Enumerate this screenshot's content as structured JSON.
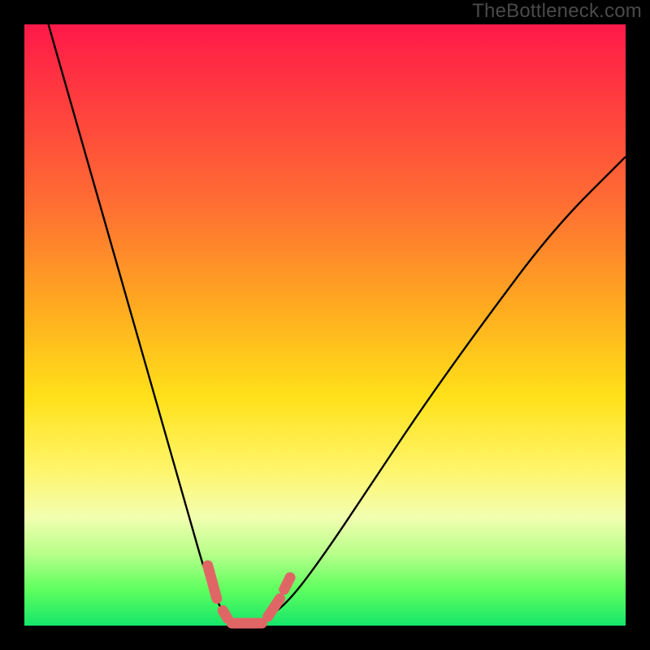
{
  "watermark": "TheBottleneck.com",
  "colors": {
    "background": "#000000",
    "gradient_top": "#ff1a49",
    "gradient_mid": "#ffe11a",
    "gradient_bottom": "#16e66a",
    "curve": "#000000",
    "marker": "#e06666"
  },
  "chart_data": {
    "type": "line",
    "title": "",
    "xlabel": "",
    "ylabel": "",
    "xlim": [
      0,
      100
    ],
    "ylim": [
      0,
      100
    ],
    "grid": false,
    "legend": false,
    "series": [
      {
        "name": "bottleneck-curve",
        "x": [
          4,
          8,
          12,
          16,
          20,
          24,
          28,
          30,
          32,
          34,
          36,
          38,
          40,
          44,
          50,
          58,
          66,
          76,
          88,
          100
        ],
        "y": [
          100,
          86,
          72,
          58,
          44,
          30,
          16,
          9,
          4,
          1,
          0,
          0,
          1,
          4,
          12,
          24,
          36,
          50,
          66,
          78
        ]
      }
    ],
    "markers": [
      {
        "name": "valley-left-dash",
        "x0": 30.5,
        "y0": 10,
        "x1": 32,
        "y1": 4.5
      },
      {
        "name": "valley-left-dot",
        "x0": 33,
        "y0": 2.5,
        "x1": 33.8,
        "y1": 1.2
      },
      {
        "name": "valley-floor",
        "x0": 34.5,
        "y0": 0.4,
        "x1": 39.5,
        "y1": 0.4
      },
      {
        "name": "valley-right-dash",
        "x0": 40.5,
        "y0": 1.5,
        "x1": 42.5,
        "y1": 4.5
      },
      {
        "name": "valley-right-dot",
        "x0": 43.2,
        "y0": 6.0,
        "x1": 44.2,
        "y1": 8.0
      }
    ]
  }
}
